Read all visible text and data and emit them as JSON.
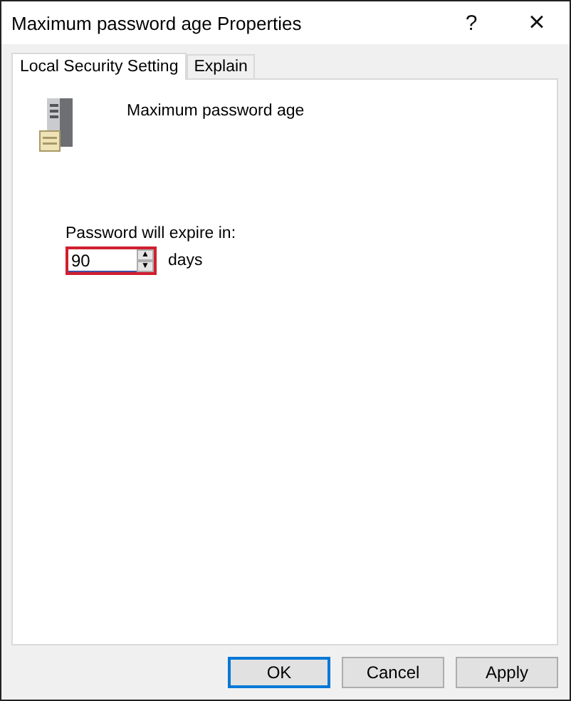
{
  "window": {
    "title": "Maximum password age Properties",
    "help": "?",
    "close": "×"
  },
  "tabs": [
    {
      "label": "Local Security Setting",
      "selected": true
    },
    {
      "label": "Explain",
      "selected": false
    }
  ],
  "policy": {
    "name": "Maximum password age"
  },
  "expiry": {
    "label": "Password will expire in:",
    "value": "90",
    "unit": "days",
    "highlighted": true,
    "up": "▲",
    "down": "▼"
  },
  "buttons": [
    {
      "label": "OK",
      "default": true
    },
    {
      "label": "Cancel",
      "default": false
    },
    {
      "label": "Apply",
      "default": false
    }
  ]
}
